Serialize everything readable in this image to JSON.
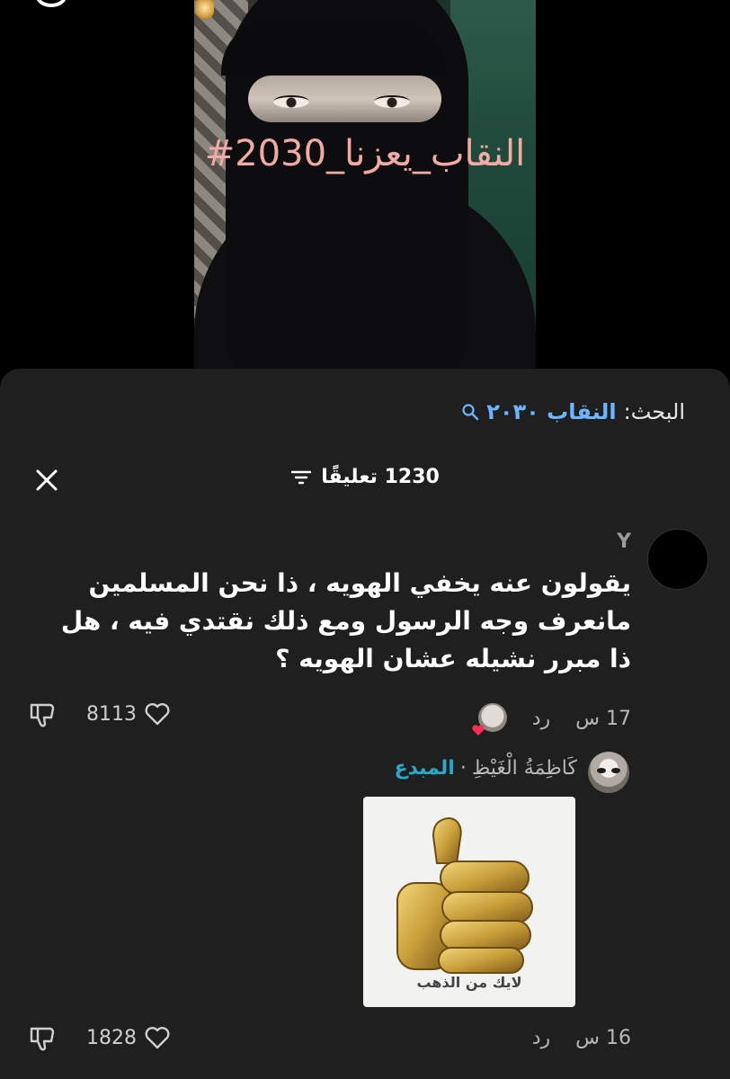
{
  "video": {
    "hashtag": "#النقاب_يعزنا_2030"
  },
  "sheet": {
    "search_label": "البحث:",
    "search_term": "النقاب ٢٠٣٠",
    "title": "1230 تعليقًا",
    "comments": [
      {
        "username": "Y",
        "text": "يقولون عنه يخفي الهويه ، ذا نحن المسلمين مانعرف وجه الرسول ومع ذلك نقتدي فيه ، هل ذا مبرر نشيله عشان الهويه ؟",
        "time": "17 س",
        "reply_label": "رد",
        "likes": "8113"
      }
    ],
    "reply": {
      "username": "كَاظِمَةُ الْغَيْظِ",
      "separator": "·",
      "creator_tag": "المبدع",
      "sticker_caption": "لايك من الذهب",
      "time": "16 س",
      "reply_label": "رد",
      "likes": "1828"
    }
  },
  "colors": {
    "sheet_bg": "#1f1f1f",
    "search_term": "#6db5ff",
    "creator_tag": "#2aa7c9",
    "hashtag": "#f4aaa4",
    "heart_badge": "#fe2c55"
  },
  "icons": [
    "search-icon",
    "close-icon",
    "filter-icon",
    "heart-icon",
    "dislike-icon",
    "thumbs-up-sticker"
  ]
}
